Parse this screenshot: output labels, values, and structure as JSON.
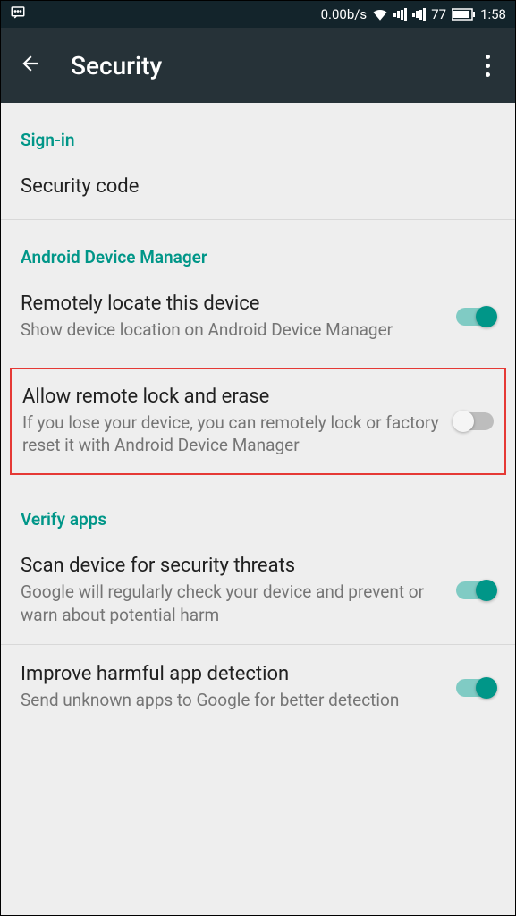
{
  "statusBar": {
    "dataRate": "0.00b/s",
    "battery": "77",
    "time": "1:58"
  },
  "appBar": {
    "title": "Security"
  },
  "sections": {
    "signIn": {
      "header": "Sign-in",
      "items": {
        "securityCode": {
          "title": "Security code"
        }
      }
    },
    "adm": {
      "header": "Android Device Manager",
      "items": {
        "remoteLocate": {
          "title": "Remotely locate this device",
          "desc": "Show device location on Android Device Manager",
          "enabled": true
        },
        "remoteLockErase": {
          "title": "Allow remote lock and erase",
          "desc": "If you lose your device, you can remotely lock or factory reset it with Android Device Manager",
          "enabled": false
        }
      }
    },
    "verifyApps": {
      "header": "Verify apps",
      "items": {
        "scanThreats": {
          "title": "Scan device for security threats",
          "desc": "Google will regularly check your device and prevent or warn about potential harm",
          "enabled": true
        },
        "improveDetection": {
          "title": "Improve harmful app detection",
          "desc": "Send unknown apps to Google for better detection",
          "enabled": true
        }
      }
    }
  }
}
